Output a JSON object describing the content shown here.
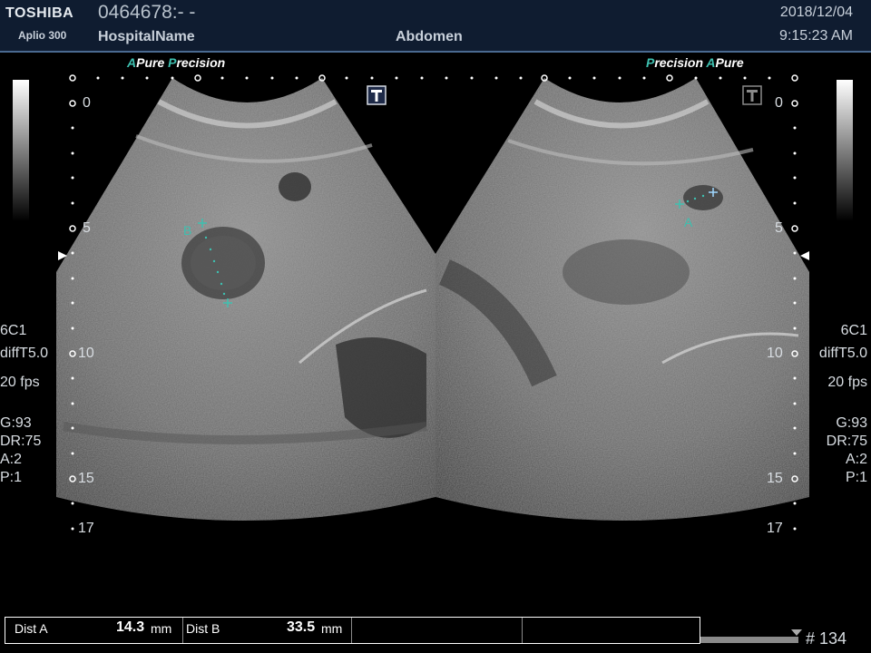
{
  "header": {
    "brand": "TOSHIBA",
    "model": "Aplio 300",
    "patient_id": "0464678:- -",
    "hospital": "HospitalName",
    "exam": "Abdomen",
    "date": "2018/12/04",
    "time": "9:15:23 AM"
  },
  "left_panel": {
    "mode_a": "A",
    "mode_a_text": "Pure",
    "mode_p": "P",
    "mode_p_text": "recision",
    "depth_ticks": [
      "0",
      "5",
      "10",
      "15",
      "17"
    ],
    "probe": "6C1",
    "freq": "diffT5.0",
    "fps": "20 fps",
    "gain": "G:93",
    "dr": "DR:75",
    "a_val": "A:2",
    "p_val": "P:1",
    "caliper_label": "B"
  },
  "right_panel": {
    "mode_p": "P",
    "mode_p_text": "recision",
    "mode_a": "A",
    "mode_a_text": "Pure",
    "depth_ticks": [
      "0",
      "5",
      "10",
      "15",
      "17"
    ],
    "probe": "6C1",
    "freq": "diffT5.0",
    "fps": "20 fps",
    "gain": "G:93",
    "dr": "DR:75",
    "a_val": "A:2",
    "p_val": "P:1",
    "caliper_label": "A"
  },
  "measurements": {
    "dist_a_label": "Dist A",
    "dist_a_value": "14.3",
    "dist_a_unit": "mm",
    "dist_b_label": "Dist B",
    "dist_b_value": "33.5",
    "dist_b_unit": "mm"
  },
  "frame_counter": "# 134",
  "colors": {
    "header_bg": "#0f1c30",
    "caliper": "#3ec0b0",
    "accent": "#3ec0b0"
  },
  "icons": {
    "left_marker": "t-marker-icon",
    "right_marker": "t-marker-icon"
  }
}
